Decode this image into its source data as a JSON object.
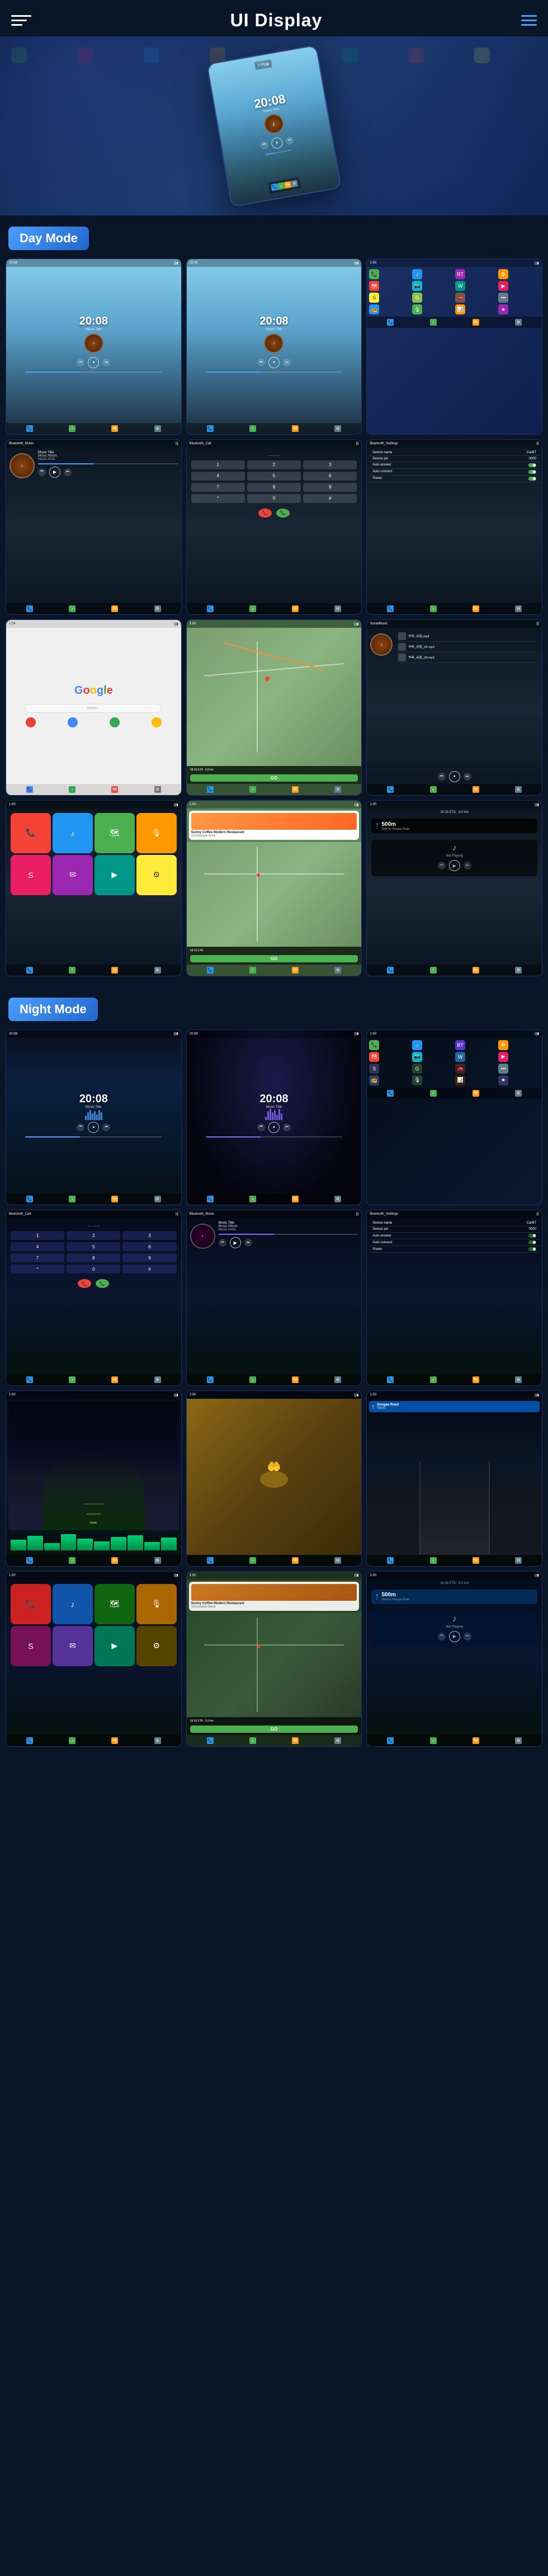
{
  "header": {
    "title": "UI Display",
    "menu_icon_alt": "menu-icon",
    "nav_icon_alt": "nav-icon"
  },
  "sections": {
    "day_mode": {
      "label": "Day Mode",
      "screens": [
        {
          "id": "day-music-1",
          "type": "music",
          "time": "20:08",
          "bg": "mountain"
        },
        {
          "id": "day-music-2",
          "type": "music",
          "time": "20:08",
          "bg": "mountain"
        },
        {
          "id": "day-apps",
          "type": "apps",
          "bg": "dark"
        },
        {
          "id": "day-bt-music",
          "type": "bluetooth_music",
          "label": "Bluetooth_Music"
        },
        {
          "id": "day-bt-call",
          "type": "bluetooth_call",
          "label": "Bluetooth_Call"
        },
        {
          "id": "day-bt-settings",
          "type": "bluetooth_settings",
          "label": "Bluetooth_Settings"
        },
        {
          "id": "day-google",
          "type": "google"
        },
        {
          "id": "day-nav",
          "type": "navigation"
        },
        {
          "id": "day-social",
          "type": "social_music",
          "label": "SocialMusic"
        }
      ]
    },
    "day_row2": {
      "screens": [
        {
          "id": "day-carplay",
          "type": "carplay"
        },
        {
          "id": "day-nav2",
          "type": "navigation2"
        },
        {
          "id": "day-notplaying",
          "type": "not_playing"
        }
      ]
    },
    "night_mode": {
      "label": "Night Mode",
      "screens": [
        {
          "id": "night-music-1",
          "type": "music_night",
          "time": "20:08"
        },
        {
          "id": "night-music-2",
          "type": "music_night2",
          "time": "20:08"
        },
        {
          "id": "night-apps",
          "type": "apps_night"
        },
        {
          "id": "night-bt-call",
          "type": "bluetooth_call_night",
          "label": "Bluetooth_Call"
        },
        {
          "id": "night-bt-music",
          "type": "bluetooth_music_night",
          "label": "Bluetooth_Music"
        },
        {
          "id": "night-bt-settings",
          "type": "bluetooth_settings_night",
          "label": "Bluetooth_Settings"
        },
        {
          "id": "night-eq",
          "type": "equalizer"
        },
        {
          "id": "night-food",
          "type": "food_photo"
        },
        {
          "id": "night-drive",
          "type": "drive_view"
        }
      ]
    },
    "night_row2": {
      "screens": [
        {
          "id": "night-carplay",
          "type": "carplay_night"
        },
        {
          "id": "night-nav",
          "type": "navigation_night"
        },
        {
          "id": "night-notplaying",
          "type": "not_playing_night"
        }
      ]
    }
  },
  "music": {
    "title": "Music Title",
    "album": "Music Album",
    "artist": "Music Artist",
    "time": "20:08"
  },
  "bluetooth": {
    "device_name": "CarBT",
    "device_pin": "0000",
    "settings_label": "Bluetooth_Settings"
  },
  "navigation": {
    "eta": "18:16 ETA",
    "distance": "9.0 km",
    "street": "Start on Dongae Road"
  },
  "coffee_shop": {
    "name": "Sunny Coffee Modern Restaurant",
    "address": "123 Example Street",
    "eta_label": "18:16 ETA",
    "go_label": "GO"
  },
  "icons": {
    "menu": "≡",
    "nav": "—",
    "play": "▶",
    "pause": "⏸",
    "prev": "⏮",
    "next": "⏭",
    "phone": "📞",
    "music": "♪",
    "map": "🗺",
    "settings": "⚙",
    "back": "↩",
    "search": "🔍",
    "home": "🏠",
    "arrow_right": "➤",
    "arrow_up": "↑"
  },
  "statusbar": {
    "time_left": "1:00",
    "signal": "|||",
    "battery": "▮",
    "wifi": "WiFi"
  }
}
